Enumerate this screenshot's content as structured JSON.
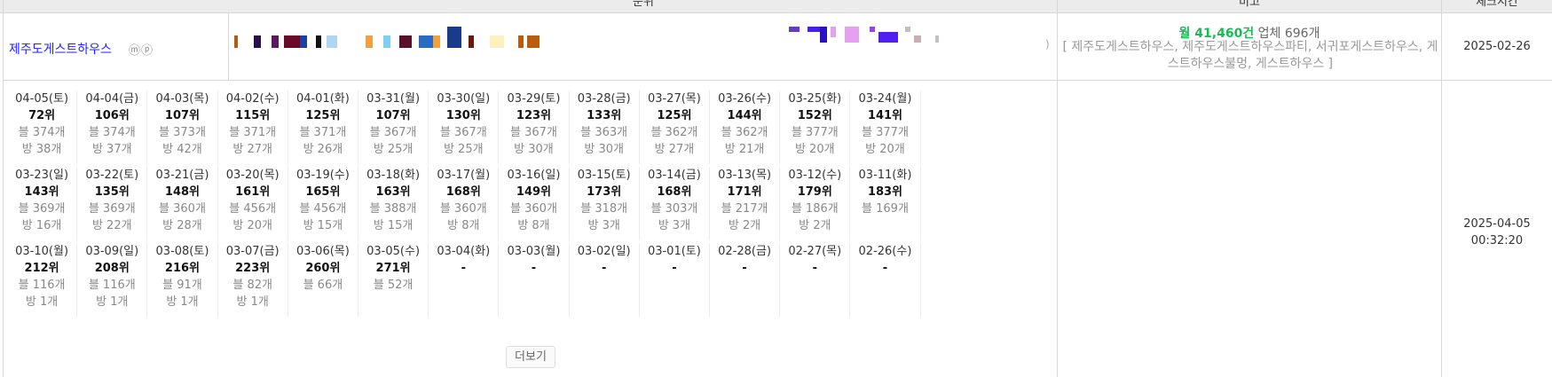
{
  "header": {
    "col_keyword": "",
    "col_ranking": "순위",
    "col_notes": "비고",
    "col_checktime": "체크시간"
  },
  "keyword": {
    "name": "제주도게스트하우스",
    "icons": "ⓜⓟ"
  },
  "summary": {
    "monthly_label": "월 41,460건",
    "business_count": "업체 696개",
    "related": "[ 제주도게스트하우스, 제주도게스트하우스파티, 서귀포게스트하우스, 게스트하우스불멍, 게스트하우스 ]",
    "scroll_mark": ")"
  },
  "dates": {
    "registered": "2025-02-26",
    "checked_date": "2025-04-05",
    "checked_time": "00:32:20"
  },
  "ranks": [
    {
      "date": "04-05(토)",
      "rank": "72위",
      "blog": "블 374개",
      "room": "방 38개"
    },
    {
      "date": "04-04(금)",
      "rank": "106위",
      "blog": "블 374개",
      "room": "방 37개"
    },
    {
      "date": "04-03(목)",
      "rank": "107위",
      "blog": "블 373개",
      "room": "방 42개"
    },
    {
      "date": "04-02(수)",
      "rank": "115위",
      "blog": "블 371개",
      "room": "방 27개"
    },
    {
      "date": "04-01(화)",
      "rank": "125위",
      "blog": "블 371개",
      "room": "방 26개"
    },
    {
      "date": "03-31(월)",
      "rank": "107위",
      "blog": "블 367개",
      "room": "방 25개"
    },
    {
      "date": "03-30(일)",
      "rank": "130위",
      "blog": "블 367개",
      "room": "방 25개"
    },
    {
      "date": "03-29(토)",
      "rank": "123위",
      "blog": "블 367개",
      "room": "방 30개"
    },
    {
      "date": "03-28(금)",
      "rank": "133위",
      "blog": "블 363개",
      "room": "방 30개"
    },
    {
      "date": "03-27(목)",
      "rank": "125위",
      "blog": "블 362개",
      "room": "방 27개"
    },
    {
      "date": "03-26(수)",
      "rank": "144위",
      "blog": "블 362개",
      "room": "방 21개"
    },
    {
      "date": "03-25(화)",
      "rank": "152위",
      "blog": "블 377개",
      "room": "방 20개"
    },
    {
      "date": "03-24(월)",
      "rank": "141위",
      "blog": "블 377개",
      "room": "방 20개"
    },
    {
      "date": "03-23(일)",
      "rank": "143위",
      "blog": "블 369개",
      "room": "방 16개"
    },
    {
      "date": "03-22(토)",
      "rank": "135위",
      "blog": "블 369개",
      "room": "방 22개"
    },
    {
      "date": "03-21(금)",
      "rank": "148위",
      "blog": "블 360개",
      "room": "방 28개"
    },
    {
      "date": "03-20(목)",
      "rank": "161위",
      "blog": "블 456개",
      "room": "방 20개"
    },
    {
      "date": "03-19(수)",
      "rank": "165위",
      "blog": "블 456개",
      "room": "방 15개"
    },
    {
      "date": "03-18(화)",
      "rank": "163위",
      "blog": "블 388개",
      "room": "방 15개"
    },
    {
      "date": "03-17(월)",
      "rank": "168위",
      "blog": "블 360개",
      "room": "방 8개"
    },
    {
      "date": "03-16(일)",
      "rank": "149위",
      "blog": "블 360개",
      "room": "방 8개"
    },
    {
      "date": "03-15(토)",
      "rank": "173위",
      "blog": "블 318개",
      "room": "방 3개"
    },
    {
      "date": "03-14(금)",
      "rank": "168위",
      "blog": "블 303개",
      "room": "방 3개"
    },
    {
      "date": "03-13(목)",
      "rank": "171위",
      "blog": "블 217개",
      "room": "방 2개"
    },
    {
      "date": "03-12(수)",
      "rank": "179위",
      "blog": "블 186개",
      "room": "방 2개"
    },
    {
      "date": "03-11(화)",
      "rank": "183위",
      "blog": "블 169개",
      "room": ""
    },
    {
      "date": "03-10(월)",
      "rank": "212위",
      "blog": "블 116개",
      "room": "방 1개"
    },
    {
      "date": "03-09(일)",
      "rank": "208위",
      "blog": "블 116개",
      "room": "방 1개"
    },
    {
      "date": "03-08(토)",
      "rank": "216위",
      "blog": "블 91개",
      "room": "방 1개"
    },
    {
      "date": "03-07(금)",
      "rank": "223위",
      "blog": "블 82개",
      "room": "방 1개"
    },
    {
      "date": "03-06(목)",
      "rank": "260위",
      "blog": "블 66개",
      "room": ""
    },
    {
      "date": "03-05(수)",
      "rank": "271위",
      "blog": "블 52개",
      "room": ""
    },
    {
      "date": "03-04(화)",
      "rank": "-",
      "blog": "",
      "room": ""
    },
    {
      "date": "03-03(월)",
      "rank": "-",
      "blog": "",
      "room": ""
    },
    {
      "date": "03-02(일)",
      "rank": "-",
      "blog": "",
      "room": ""
    },
    {
      "date": "03-01(토)",
      "rank": "-",
      "blog": "",
      "room": ""
    },
    {
      "date": "02-28(금)",
      "rank": "-",
      "blog": "",
      "room": ""
    },
    {
      "date": "02-27(목)",
      "rank": "-",
      "blog": "",
      "room": ""
    },
    {
      "date": "02-26(수)",
      "rank": "-",
      "blog": "",
      "room": ""
    }
  ],
  "more_button": "더보기",
  "pixel_colors": [
    "#b85c10",
    "#2a1050",
    "#5a1a60",
    "#6a0a2a",
    "#2040a0",
    "#111111",
    "#aed6f0",
    "#f0a040",
    "#7dd0f0",
    "#5a0f2a",
    "#2a6ac0",
    "#f0a040",
    "#1a3a8a",
    "#6a1a0a",
    "#fff0c0",
    "#b85c10",
    "#6a3ac0",
    "#4a20e0",
    "#2a10c0",
    "#e6a0f0",
    "#a040e0",
    "#5020f0",
    "#c0c0c0",
    "#c8b0b0"
  ]
}
